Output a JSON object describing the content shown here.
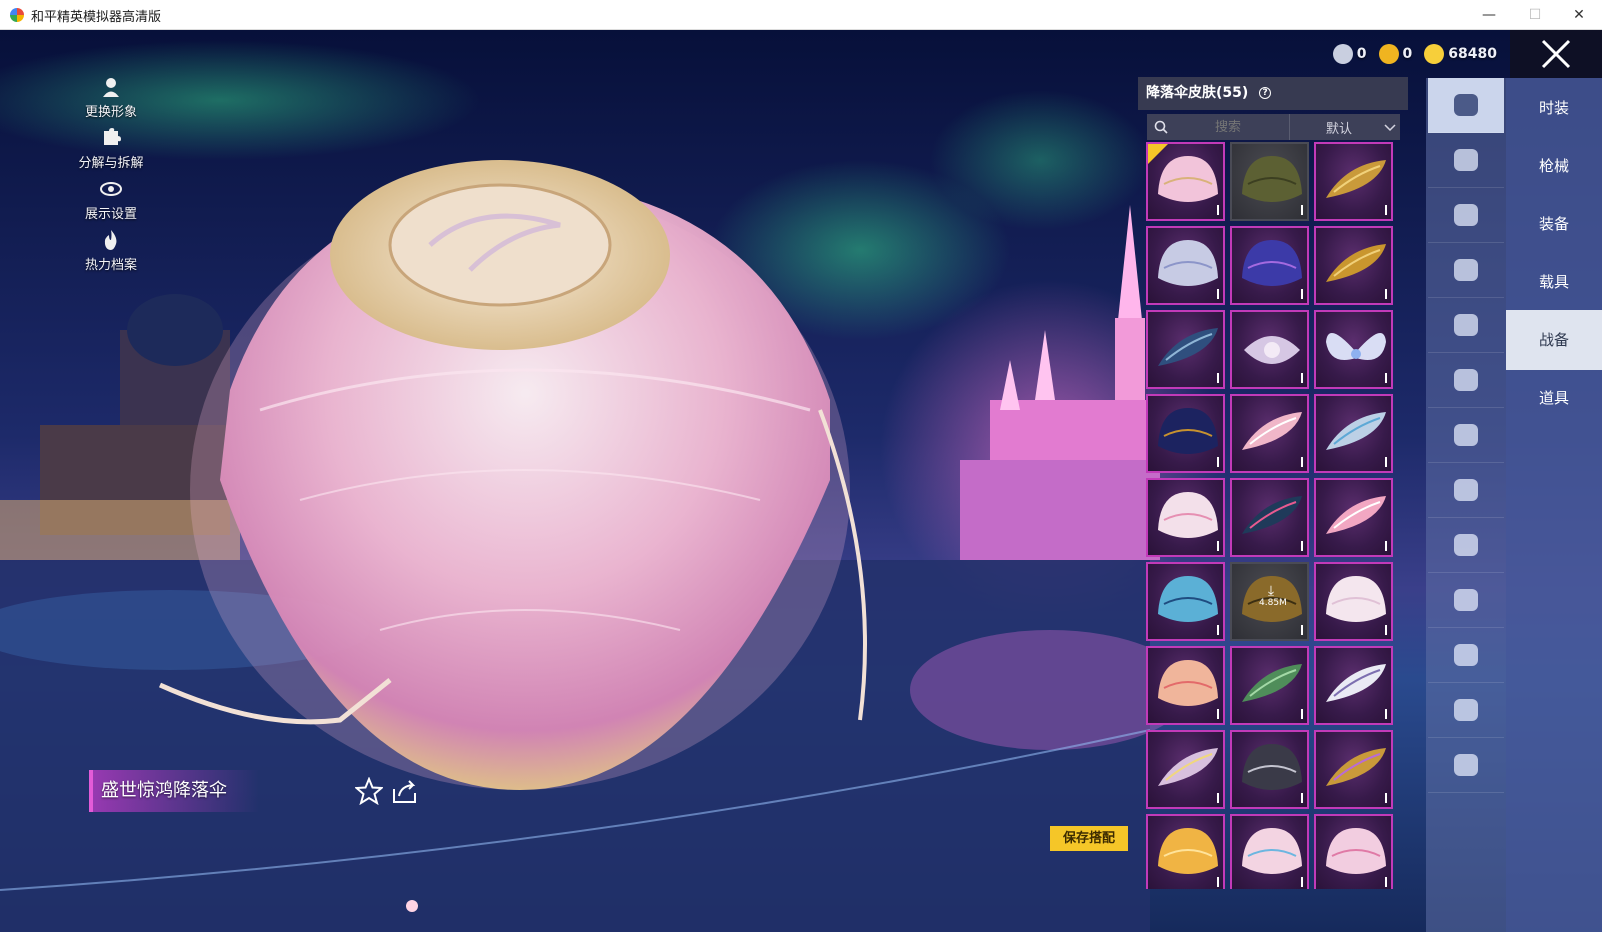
{
  "window": {
    "title": "和平精英模拟器高清版",
    "controls": {
      "minimize": "—",
      "maximize": "☐",
      "close": "✕"
    }
  },
  "left_tools": [
    {
      "label": "更换形象",
      "icon": "person-icon"
    },
    {
      "label": "分解与拆解",
      "icon": "puzzle-icon"
    },
    {
      "label": "展示设置",
      "icon": "eye-icon"
    },
    {
      "label": "热力档案",
      "icon": "flame-icon"
    }
  ],
  "currency": [
    {
      "value": "0",
      "icon": "silver-coin-icon",
      "color": "#c9cfe0"
    },
    {
      "value": "0",
      "icon": "gold-a-coin-icon",
      "color": "#f0b420"
    },
    {
      "value": "68480",
      "icon": "gold-coin-icon",
      "color": "#f7cf3a"
    }
  ],
  "panel": {
    "title": "降落伞皮肤(55)",
    "help_icon": "help-circle-icon",
    "search_placeholder": "搜索",
    "sort_value": "默认",
    "download_size": "4.85M"
  },
  "grid_items": [
    {
      "color": "#f2c4da",
      "accent": "#d9b27a",
      "shape": "dome",
      "equipped": true
    },
    {
      "color": "#5c6033",
      "accent": "#3c3f21",
      "shape": "dome",
      "plain": true
    },
    {
      "color": "#c99a3a",
      "accent": "#f1d27a",
      "shape": "wing"
    },
    {
      "color": "#c7cbe4",
      "accent": "#8c95c9",
      "shape": "dome"
    },
    {
      "color": "#3c3aa8",
      "accent": "#a46ae0",
      "shape": "dome"
    },
    {
      "color": "#c9962e",
      "accent": "#f0d07a",
      "shape": "wing"
    },
    {
      "color": "#2f4f7e",
      "accent": "#8fb6d6",
      "shape": "wing"
    },
    {
      "color": "#d6c7e4",
      "accent": "#f3eaf6",
      "shape": "diamond"
    },
    {
      "color": "#d9ddf4",
      "accent": "#8eb1f0",
      "shape": "butterfly"
    },
    {
      "color": "#1c2360",
      "accent": "#c7922f",
      "shape": "dome"
    },
    {
      "color": "#f0b6c8",
      "accent": "#ffffff",
      "shape": "wing"
    },
    {
      "color": "#bcd0e6",
      "accent": "#5da8d6",
      "shape": "wing"
    },
    {
      "color": "#f3e0ea",
      "accent": "#e68fb2",
      "shape": "dome"
    },
    {
      "color": "#1f3a5a",
      "accent": "#e85a90",
      "shape": "wing"
    },
    {
      "color": "#f2a7c2",
      "accent": "#ffffff",
      "shape": "wing"
    },
    {
      "color": "#5bb0d6",
      "accent": "#1f4c80",
      "shape": "dome"
    },
    {
      "color": "#8a6a2a",
      "accent": "#3b2e12",
      "shape": "dome",
      "plain": true,
      "download": true
    },
    {
      "color": "#f4e6ee",
      "accent": "#e0c1d6",
      "shape": "dome"
    },
    {
      "color": "#f0b59b",
      "accent": "#e36a6a",
      "shape": "dome"
    },
    {
      "color": "#4f8d5a",
      "accent": "#a3d9a6",
      "shape": "wing"
    },
    {
      "color": "#eaeaf4",
      "accent": "#7d6fb0",
      "shape": "wing"
    },
    {
      "color": "#d8c0de",
      "accent": "#f0d77d",
      "shape": "wing"
    },
    {
      "color": "#3a3a48",
      "accent": "#c4c4d0",
      "shape": "dome"
    },
    {
      "color": "#c99a3a",
      "accent": "#b86bd6",
      "shape": "wing"
    },
    {
      "color": "#f0b444",
      "accent": "#ffe39a",
      "shape": "dome"
    },
    {
      "color": "#f3d4e2",
      "accent": "#6cb6e0",
      "shape": "dome"
    },
    {
      "color": "#f2cde0",
      "accent": "#e07aa6",
      "shape": "dome"
    }
  ],
  "category_icons": [
    "parachute-icon",
    "boat-icon",
    "drone-icon",
    "plane-icon",
    "face-icon",
    "robot-icon",
    "speaker-icon",
    "chat-icon",
    "photo-icon",
    "spray-icon",
    "hand-tap-icon",
    "sparkle-icon",
    "roast-chicken-icon"
  ],
  "nav": [
    {
      "label": "时装",
      "active": false
    },
    {
      "label": "枪械",
      "active": false
    },
    {
      "label": "装备",
      "active": false
    },
    {
      "label": "载具",
      "active": false
    },
    {
      "label": "战备",
      "active": true
    },
    {
      "label": "道具",
      "active": false
    }
  ],
  "item_name": "盛世惊鸿降落伞",
  "save_button": "保存搭配"
}
